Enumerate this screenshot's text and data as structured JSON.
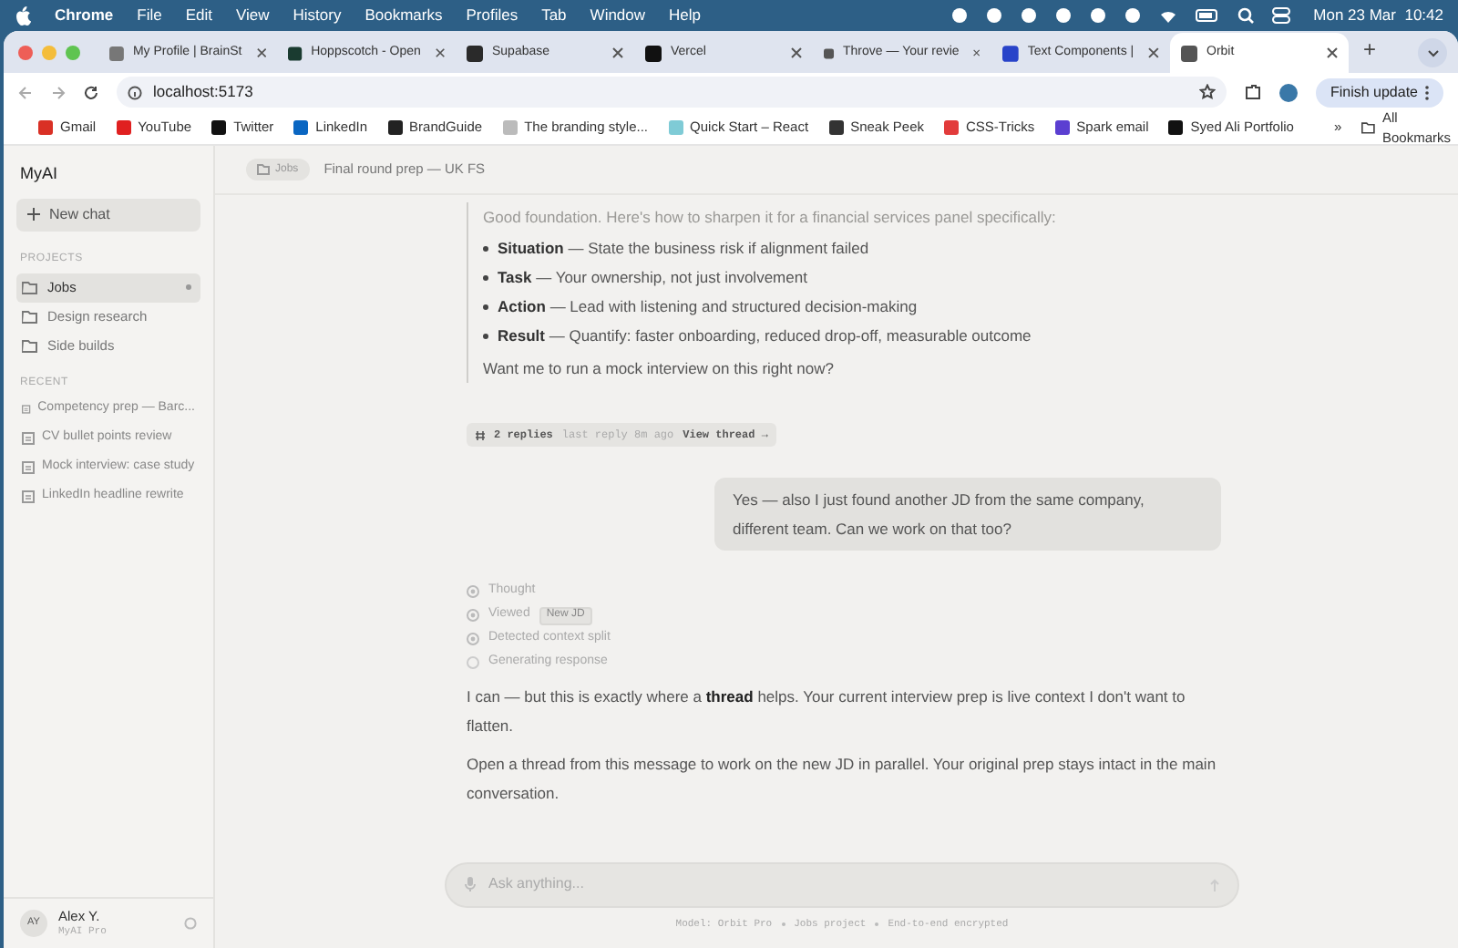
{
  "menu_bar": {
    "app": "Chrome",
    "items": [
      "File",
      "Edit",
      "View",
      "History",
      "Bookmarks",
      "Profiles",
      "Tab",
      "Window",
      "Help"
    ],
    "clock": "Mon 23 Mar  10:42"
  },
  "tabs": [
    {
      "label": "My Profile | BrainSt",
      "selected": false
    },
    {
      "label": "Hoppscotch - Open",
      "selected": false
    },
    {
      "label": "Supabase",
      "selected": false
    },
    {
      "label": "Vercel",
      "selected": false
    },
    {
      "label": "Throve — Your revie",
      "selected": false
    },
    {
      "label": "Text Components |",
      "selected": false
    },
    {
      "label": "Orbit",
      "selected": true
    }
  ],
  "new_tab": "+",
  "address_bar": {
    "url": "localhost:5173",
    "update_button": "Finish update"
  },
  "bookmarks": [
    "Gmail",
    "YouTube",
    "Twitter",
    "LinkedIn",
    "BrandGuide",
    "The branding style...",
    "Quick Start – React",
    "Sneak Peek",
    "CSS-Tricks",
    "Spark email",
    "Syed Ali Portfolio"
  ],
  "bookmarks_overflow": "»",
  "all_bookmarks": "All Bookmarks",
  "sidebar": {
    "brand": "MyAI",
    "new_chat": "New chat",
    "projects_heading": "PROJECTS",
    "projects": [
      {
        "label": "Jobs",
        "selected": true
      },
      {
        "label": "Design research",
        "selected": false
      },
      {
        "label": "Side builds",
        "selected": false
      }
    ],
    "recent_heading": "RECENT",
    "recent": [
      "Competency prep — Barc...",
      "CV bullet points review",
      "Mock interview: case study",
      "LinkedIn headline rewrite"
    ],
    "user": {
      "initials": "AY",
      "name": "Alex Y.",
      "plan": "MyAI Pro"
    }
  },
  "breadcrumb": {
    "project": "Jobs",
    "title": "Final round prep — UK FS"
  },
  "messages": [
    {
      "kind": "assistant",
      "paragraphs": [
        "Good foundation. Here's how to sharpen it for a financial services panel specifically:"
      ],
      "bullets": [
        "**Situation** — State the business risk if alignment failed",
        "**Task** — Your ownership, not just involvement",
        "**Action** — Lead with listening and structured decision-making",
        "**Result** — Quantify: faster onboarding, reduced drop-off, measurable outcome"
      ],
      "closing": "Want me to run a mock interview on this right now?",
      "thread": {
        "replies": "2 replies",
        "last": "last reply 8m ago",
        "link": "View thread →"
      }
    },
    {
      "kind": "user",
      "text": "Yes — also I just found another JD from the same company, different team. Can we work on that too?"
    },
    {
      "kind": "steps",
      "steps": [
        {
          "label": "Thought",
          "done": true
        },
        {
          "label": "Viewed",
          "tag": "New JD",
          "done": true
        },
        {
          "label": "Detected context split",
          "done": true
        },
        {
          "label": "Generating response",
          "done": false
        }
      ]
    },
    {
      "kind": "assistant",
      "paragraphs": [
        "I can — but this is exactly where a **thread** helps. Your current interview prep is live context I don't want to flatten.",
        "Open a thread from this message to work on the new JD in parallel. Your original prep stays intact in the main conversation."
      ]
    }
  ],
  "composer": {
    "placeholder": "Ask anything..."
  },
  "footer": [
    "Model: Orbit Pro",
    "Jobs project",
    "End-to-end encrypted"
  ]
}
